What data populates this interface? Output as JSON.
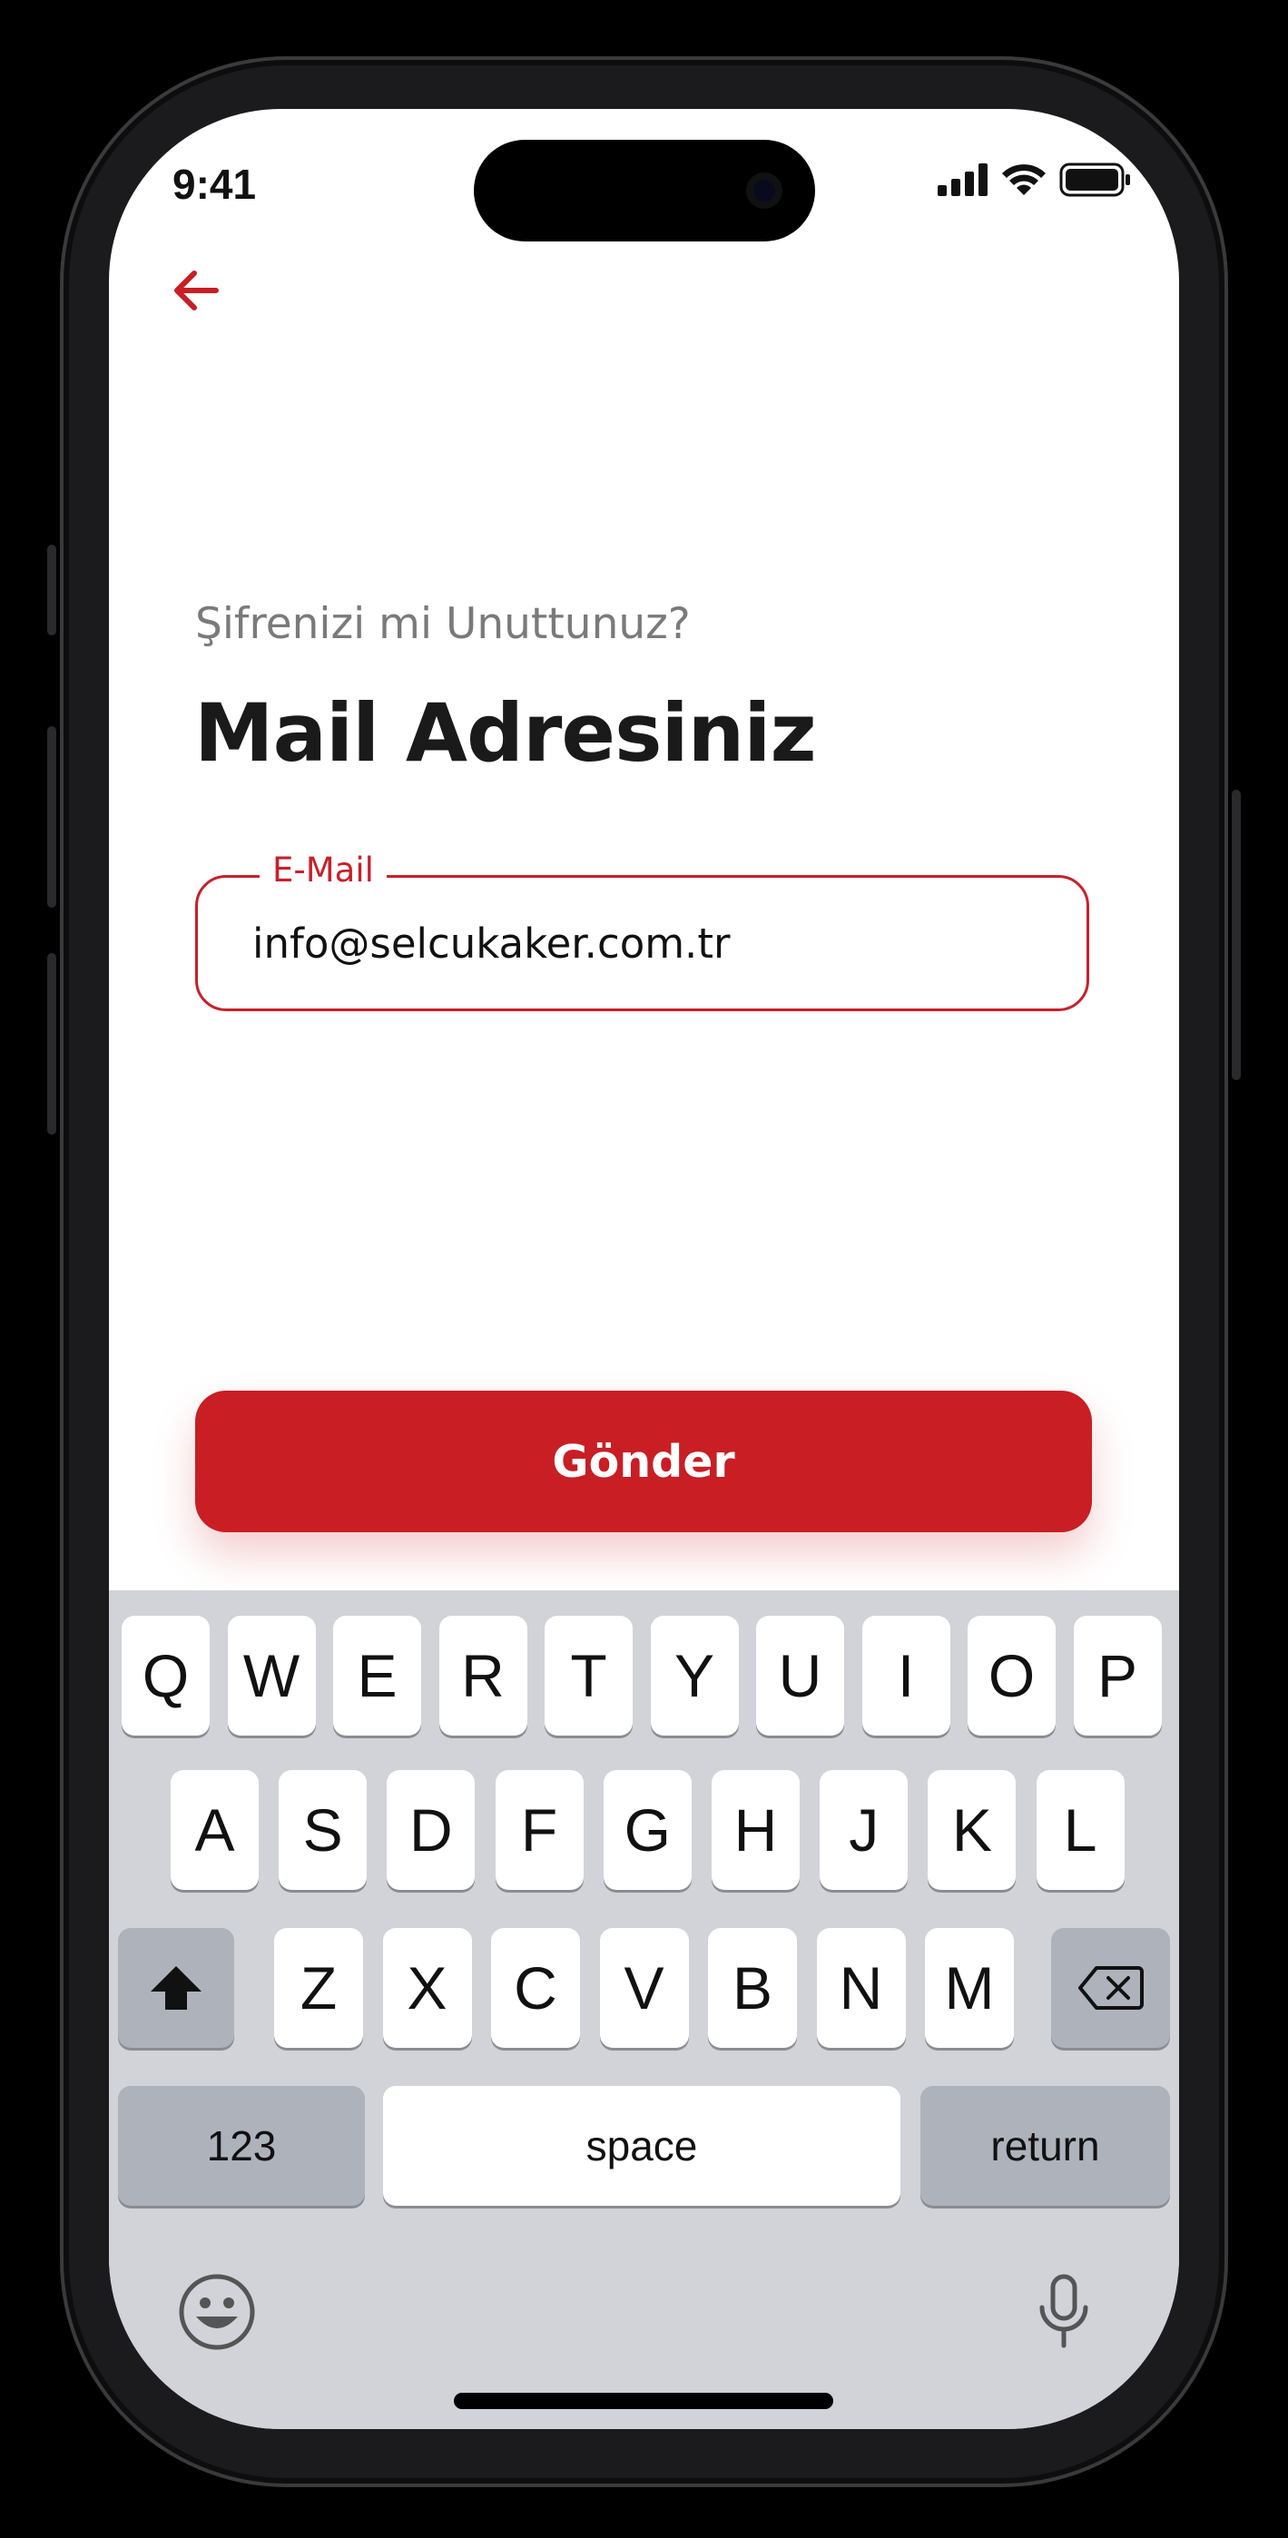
{
  "status_bar": {
    "time": "9:41"
  },
  "header": {
    "back_icon": "arrow-left-icon"
  },
  "content": {
    "subtitle": "Şifrenizi mi Unuttunuz?",
    "title": "Mail Adresiniz",
    "email_field": {
      "label": "E-Mail",
      "value": "info@selcukaker.com.tr"
    },
    "send_button": "Gönder"
  },
  "keyboard": {
    "row1": [
      "Q",
      "W",
      "E",
      "R",
      "T",
      "Y",
      "U",
      "I",
      "O",
      "P"
    ],
    "row2": [
      "A",
      "S",
      "D",
      "F",
      "G",
      "H",
      "J",
      "K",
      "L"
    ],
    "row3": [
      "Z",
      "X",
      "C",
      "V",
      "B",
      "N",
      "M"
    ],
    "numbers_key": "123",
    "space_key": "space",
    "return_key": "return"
  },
  "colors": {
    "accent": "#c81e24",
    "keyboard_bg": "#d1d3d9"
  }
}
